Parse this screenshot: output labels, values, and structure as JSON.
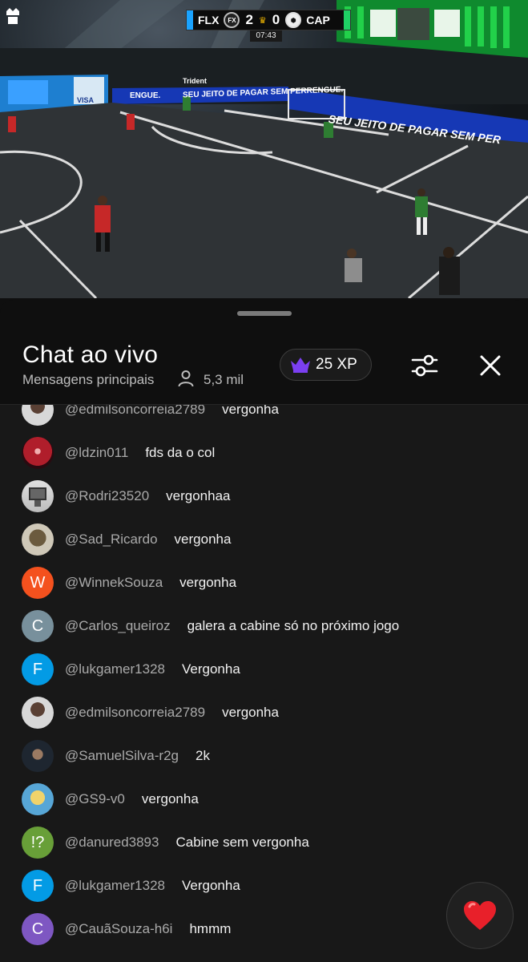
{
  "scoreboard": {
    "home_team": "FLX",
    "home_score": "2",
    "away_score": "0",
    "away_team": "CAP",
    "clock": "07:43",
    "home_badge": "FX"
  },
  "field_banners": {
    "banner_1": "SEU JEITO DE PAGAR SEM PERRENGUE.",
    "banner_2": "SEU JEITO DE PAGAR SEM PER",
    "banner_left": "ENGUE.",
    "sponsor_1": "VISA",
    "sponsor_2": "Trident"
  },
  "header": {
    "title": "Chat ao vivo",
    "subtitle": "Mensagens principais",
    "viewers": "5,3 mil",
    "xp_label": "25 XP"
  },
  "colors": {
    "background": "#0f0f0f",
    "chat_background": "#181818",
    "author": "#aaaaaa",
    "crown": "#7b3ff2"
  },
  "messages": [
    {
      "author": "@edmilsoncorreia2789",
      "text": "vergonha",
      "avatar_letter": "",
      "avatar_color": "#c9c9c9",
      "avatar_kind": "photo-face"
    },
    {
      "author": "@ldzin011",
      "text": "fds da o col",
      "avatar_letter": "",
      "avatar_color": "#b01e2b",
      "avatar_kind": "photo-red"
    },
    {
      "author": "@Rodri23520",
      "text": "vergonhaa",
      "avatar_letter": "",
      "avatar_color": "#d9d9d9",
      "avatar_kind": "photo-tv"
    },
    {
      "author": "@Sad_Ricardo",
      "text": "vergonha",
      "avatar_letter": "",
      "avatar_color": "#8a7a5c",
      "avatar_kind": "photo-groot"
    },
    {
      "author": "@WinnekSouza",
      "text": "vergonha",
      "avatar_letter": "W",
      "avatar_color": "#f4511e",
      "avatar_kind": "letter"
    },
    {
      "author": "@Carlos_queiroz",
      "text": "galera a cabine só no próximo jogo",
      "avatar_letter": "C",
      "avatar_color": "#78909c",
      "avatar_kind": "letter"
    },
    {
      "author": "@lukgamer1328",
      "text": "Vergonha",
      "avatar_letter": "F",
      "avatar_color": "#039be5",
      "avatar_kind": "letter"
    },
    {
      "author": "@edmilsoncorreia2789",
      "text": "vergonha",
      "avatar_letter": "",
      "avatar_color": "#c9c9c9",
      "avatar_kind": "photo-face"
    },
    {
      "author": "@SamuelSilva-r2g",
      "text": "2k",
      "avatar_letter": "",
      "avatar_color": "#2a2a2a",
      "avatar_kind": "photo-dark"
    },
    {
      "author": "@GS9-v0",
      "text": "vergonha",
      "avatar_letter": "",
      "avatar_color": "#57a6d6",
      "avatar_kind": "photo-anime"
    },
    {
      "author": "@danured3893",
      "text": "Cabine sem vergonha",
      "avatar_letter": "!?",
      "avatar_color": "#689f38",
      "avatar_kind": "letter"
    },
    {
      "author": "@lukgamer1328",
      "text": "Vergonha",
      "avatar_letter": "F",
      "avatar_color": "#039be5",
      "avatar_kind": "letter"
    },
    {
      "author": "@CauãSouza-h6i",
      "text": "hmmm",
      "avatar_letter": "C",
      "avatar_color": "#7e57c2",
      "avatar_kind": "letter"
    }
  ],
  "icons": {
    "filter": "sliders-icon",
    "close": "close-icon",
    "viewers": "person-icon",
    "xp": "crown-icon",
    "reaction": "heart-icon"
  }
}
